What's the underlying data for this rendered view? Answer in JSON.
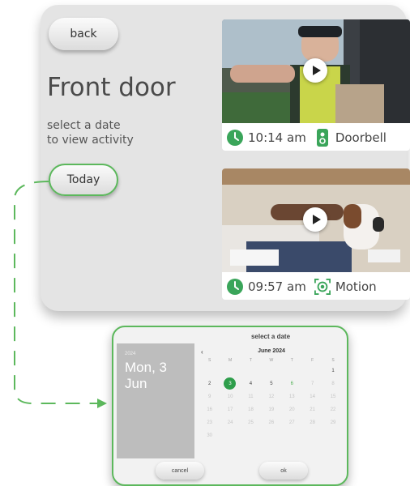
{
  "header": {
    "back_label": "back",
    "title": "Front door",
    "subtitle": "select a date\nto view activity",
    "today_label": "Today"
  },
  "events": [
    {
      "time": "10:14 am",
      "type": "Doorbell",
      "icon": "doorbell-icon"
    },
    {
      "time": "09:57 am",
      "type": "Motion",
      "icon": "motion-icon"
    }
  ],
  "date_picker": {
    "heading": "select a date",
    "year": "2024",
    "selected_display": "Mon, 3\nJun",
    "month_label": "June 2024",
    "weekdays": [
      "S",
      "M",
      "T",
      "W",
      "T",
      "F",
      "S"
    ],
    "weeks": [
      [
        "",
        "",
        "",
        "",
        "",
        "",
        "1"
      ],
      [
        "2",
        "3",
        "4",
        "5",
        "6",
        "7",
        "8"
      ],
      [
        "9",
        "10",
        "11",
        "12",
        "13",
        "14",
        "15"
      ],
      [
        "16",
        "17",
        "18",
        "19",
        "20",
        "21",
        "22"
      ],
      [
        "23",
        "24",
        "25",
        "26",
        "27",
        "28",
        "29"
      ],
      [
        "30",
        "",
        "",
        "",
        "",
        "",
        ""
      ]
    ],
    "selected_day": "3",
    "cancel_label": "cancel",
    "ok_label": "ok"
  },
  "colors": {
    "accent": "#5cb85c",
    "panel": "#e4e4e4",
    "selected_day": "#2e9e4b"
  }
}
